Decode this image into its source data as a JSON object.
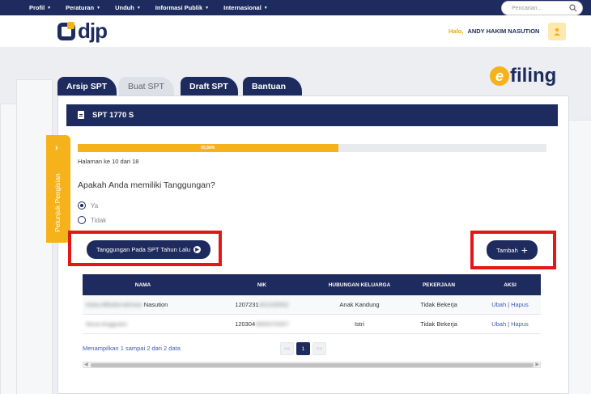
{
  "topnav": {
    "menu": [
      "Profil",
      "Peraturan",
      "Unduh",
      "Informasi Publik",
      "Internasional"
    ],
    "search_placeholder": "Pencarian..."
  },
  "header": {
    "logo_text": "djp",
    "greeting": "Halo,",
    "username": "ANDY HAKIM NASUTION"
  },
  "brand": {
    "efiling_letter": "e",
    "efiling_word": "filing"
  },
  "tabs": [
    {
      "label": "Arsip SPT",
      "active": false
    },
    {
      "label": "Buat SPT",
      "active": true
    },
    {
      "label": "Draft SPT",
      "active": false
    },
    {
      "label": "Bantuan",
      "active": false
    }
  ],
  "panel": {
    "title": "SPT 1770 S"
  },
  "side_tab": {
    "label": "Petunjuk Pengisian"
  },
  "progress": {
    "percent": 55.56,
    "label": "55,56%",
    "page_info": "Halaman ke 10 dari 18"
  },
  "question": {
    "text": "Apakah Anda memiliki Tanggungan?",
    "options": [
      {
        "label": "Ya",
        "selected": true
      },
      {
        "label": "Tidak",
        "selected": false
      }
    ]
  },
  "buttons": {
    "previous_dependents": "Tanggungan Pada SPT Tahun Lalu",
    "add": "Tambah"
  },
  "table": {
    "headers": [
      "NAMA",
      "NIK",
      "HUBUNGAN KELUARGA",
      "PEKERJAAN",
      "AKSI"
    ],
    "rows": [
      {
        "name_hidden": "Aska Althafurrahman",
        "name_visible": "Nasution",
        "nik_visible": "1207231",
        "nik_hidden": "401100002",
        "relation": "Anak Kandung",
        "job": "Tidak Bekerja"
      },
      {
        "name_hidden": "Nova Anggraini",
        "name_visible": "",
        "nik_visible": "120304",
        "nik_hidden": "4800070007",
        "relation": "Istri",
        "job": "Tidak Bekerja"
      }
    ],
    "action_edit": "Ubah",
    "action_separator": "|",
    "action_delete": "Hapus"
  },
  "footer": {
    "showing": "Menampilkan 1 sampai 2 dari 2 data",
    "pager": {
      "prev": "<<",
      "current": "1",
      "next": ">>"
    }
  },
  "colors": {
    "navy": "#1d2b5e",
    "accent": "#f6b21b",
    "highlight": "#e01818"
  }
}
